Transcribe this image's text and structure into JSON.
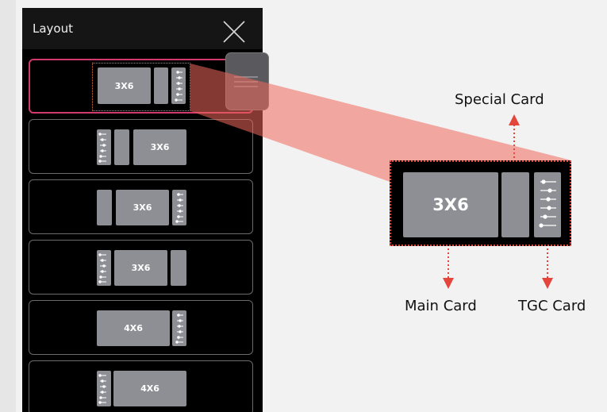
{
  "panel": {
    "title": "Layout",
    "close_icon": "close-icon",
    "options": [
      {
        "label": "3X6",
        "arrangement": [
          "main",
          "special",
          "tgc"
        ],
        "selected": true
      },
      {
        "label": "3X6",
        "arrangement": [
          "tgc",
          "special",
          "main"
        ],
        "selected": false
      },
      {
        "label": "3X6",
        "arrangement": [
          "special",
          "main",
          "tgc"
        ],
        "selected": false
      },
      {
        "label": "3X6",
        "arrangement": [
          "tgc",
          "main",
          "special"
        ],
        "selected": false
      },
      {
        "label": "4X6",
        "arrangement": [
          "main",
          "tgc"
        ],
        "selected": false
      },
      {
        "label": "4X6",
        "arrangement": [
          "tgc",
          "main"
        ],
        "selected": false
      }
    ]
  },
  "drawer_handle_icon": "menu-icon",
  "zoom": {
    "main_label": "3X6"
  },
  "annotations": {
    "special_card": "Special Card",
    "main_card": "Main Card",
    "tgc_card": "TGC Card"
  },
  "colors": {
    "panel_bg": "#000000",
    "header_bg": "#151515",
    "card_gray": "#8e8f94",
    "selected_border": "#d03a6c",
    "callout_red": "#e4463c",
    "highlight_orange": "#e57a2c",
    "beam": "#f0675b"
  }
}
